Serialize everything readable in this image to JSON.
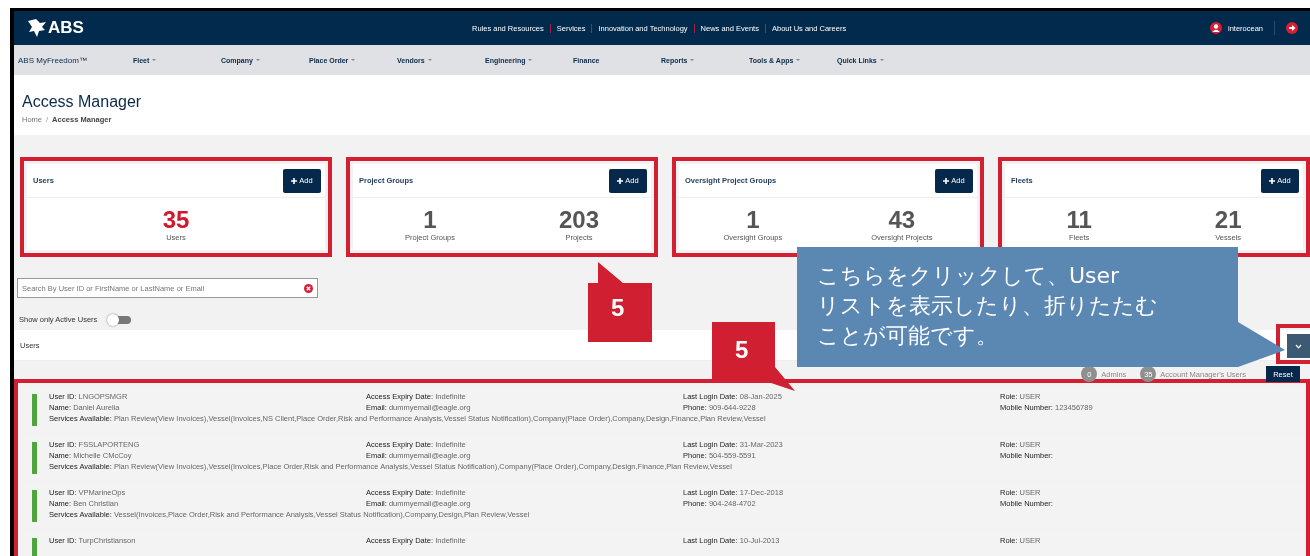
{
  "header": {
    "logo": "ABS",
    "top_links": [
      "Rules and Resources",
      "Services",
      "Innovation and Technology",
      "News and Events",
      "About Us and Careers"
    ],
    "user": "interocean"
  },
  "nav": {
    "brand": "ABS MyFreedom™",
    "items": [
      {
        "label": "Fleet",
        "dropdown": true
      },
      {
        "label": "Company",
        "dropdown": true
      },
      {
        "label": "Place Order",
        "dropdown": true
      },
      {
        "label": "Vendors",
        "dropdown": true
      },
      {
        "label": "Engineering",
        "dropdown": true
      },
      {
        "label": "Finance",
        "dropdown": false
      },
      {
        "label": "Reports",
        "dropdown": true
      },
      {
        "label": "Tools & Apps",
        "dropdown": true
      },
      {
        "label": "Quick Links",
        "dropdown": true
      }
    ]
  },
  "page": {
    "title": "Access Manager",
    "breadcrumb": {
      "items": [
        "Home",
        "Access Manager"
      ],
      "separator": "/"
    }
  },
  "cards": [
    {
      "title": "Users",
      "button": "Add",
      "highlighted": true,
      "stats": [
        {
          "value": "35",
          "label": "Users",
          "emphasized": true
        }
      ]
    },
    {
      "title": "Project Groups",
      "button": "Add",
      "highlighted": true,
      "stats": [
        {
          "value": "1",
          "label": "Project Groups",
          "emphasized": false
        },
        {
          "value": "203",
          "label": "Projects",
          "emphasized": false
        }
      ]
    },
    {
      "title": "Oversight Project Groups",
      "button": "Add",
      "highlighted": true,
      "stats": [
        {
          "value": "1",
          "label": "Oversight Groups",
          "emphasized": false
        },
        {
          "value": "43",
          "label": "Oversight Projects",
          "emphasized": false
        }
      ]
    },
    {
      "title": "Fleets",
      "button": "Add",
      "highlighted": true,
      "stats": [
        {
          "value": "11",
          "label": "Fleets",
          "emphasized": false
        },
        {
          "value": "21",
          "label": "Vessels",
          "emphasized": false
        }
      ]
    }
  ],
  "search": {
    "placeholder": "Search By User ID or FirstName or LastName or Email"
  },
  "toggle": {
    "label": "Show only Active Users",
    "on": false
  },
  "users_panel": {
    "title": "Users",
    "expanded": true,
    "button_highlighted": true
  },
  "counters": [
    {
      "count": "0",
      "label": "Admins"
    },
    {
      "count": "35",
      "label": "Account Manager's Users"
    }
  ],
  "reset": "Reset",
  "list_highlighted": true,
  "users": [
    {
      "fields": [
        {
          "label": "User ID:",
          "value": "LNGOPSMGR"
        },
        {
          "label": "Access Expiry Date:",
          "value": "Indefinite"
        },
        {
          "label": "Last Login Date:",
          "value": "08-Jan-2025"
        },
        {
          "label": "Role:",
          "value": "USER"
        },
        {
          "label": "Name:",
          "value": "Daniel Aurelia"
        },
        {
          "label": "Email:",
          "value": "dummyemail@eagle.org"
        },
        {
          "label": "Phone:",
          "value": "909-644-9228"
        },
        {
          "label": "Mobile Number:",
          "value": "123456789"
        }
      ],
      "services": {
        "label": "Services Available:",
        "value": "Plan Review(View Invoices),Vessel(Invoices,NS Client,Place Order,Risk and Performance Analysis,Vessel Status Notification),Company(Place Order),Company,Design,Finance,Plan Review,Vessel"
      }
    },
    {
      "fields": [
        {
          "label": "User ID:",
          "value": "FSSLAPORTENG"
        },
        {
          "label": "Access Expiry Date:",
          "value": "Indefinite"
        },
        {
          "label": "Last Login Date:",
          "value": "31-Mar-2023"
        },
        {
          "label": "Role:",
          "value": "USER"
        },
        {
          "label": "Name:",
          "value": "Michelle CMcCoy"
        },
        {
          "label": "Email:",
          "value": "dummyemail@eagle.org"
        },
        {
          "label": "Phone:",
          "value": "504-559-5591"
        },
        {
          "label": "Mobile Number:"
        }
      ],
      "services": {
        "label": "Services Available:",
        "value": "Plan Review(View Invoices),Vessel(Invoices,Place Order,Risk and Performance Analysis,Vessel Status Notification),Company(Place Order),Company,Design,Finance,Plan Review,Vessel"
      }
    },
    {
      "fields": [
        {
          "label": "User ID:",
          "value": "VPMarineOps"
        },
        {
          "label": "Access Expiry Date:",
          "value": "Indefinite"
        },
        {
          "label": "Last Login Date:",
          "value": "17-Dec-2018"
        },
        {
          "label": "Role:",
          "value": "USER"
        },
        {
          "label": "Name:",
          "value": "Ben Christian"
        },
        {
          "label": "Email:",
          "value": "dummyemail@eagle.org"
        },
        {
          "label": "Phone:",
          "value": "904-248-4702"
        },
        {
          "label": "Mobile Number:"
        }
      ],
      "services": {
        "label": "Services Available:",
        "value": "Vessel(Invoices,Place Order,Risk and Performance Analysis,Vessel Status Notification),Company,Design,Plan Review,Vessel"
      }
    },
    {
      "fields": [
        {
          "label": "User ID:",
          "value": "TurpChristianson"
        },
        {
          "label": "Access Expiry Date:",
          "value": "Indefinite"
        },
        {
          "label": "Last Login Date:",
          "value": "10-Jul-2013"
        },
        {
          "label": "Role:",
          "value": "USER"
        }
      ]
    }
  ],
  "annotations": {
    "badges": [
      {
        "text": "5",
        "kind": "up"
      },
      {
        "text": "5",
        "kind": "down"
      }
    ],
    "callout": {
      "lines": [
        "こちらをクリックして、User",
        "リストを表示したり、折りたたむ",
        "ことが可能です。"
      ]
    }
  }
}
